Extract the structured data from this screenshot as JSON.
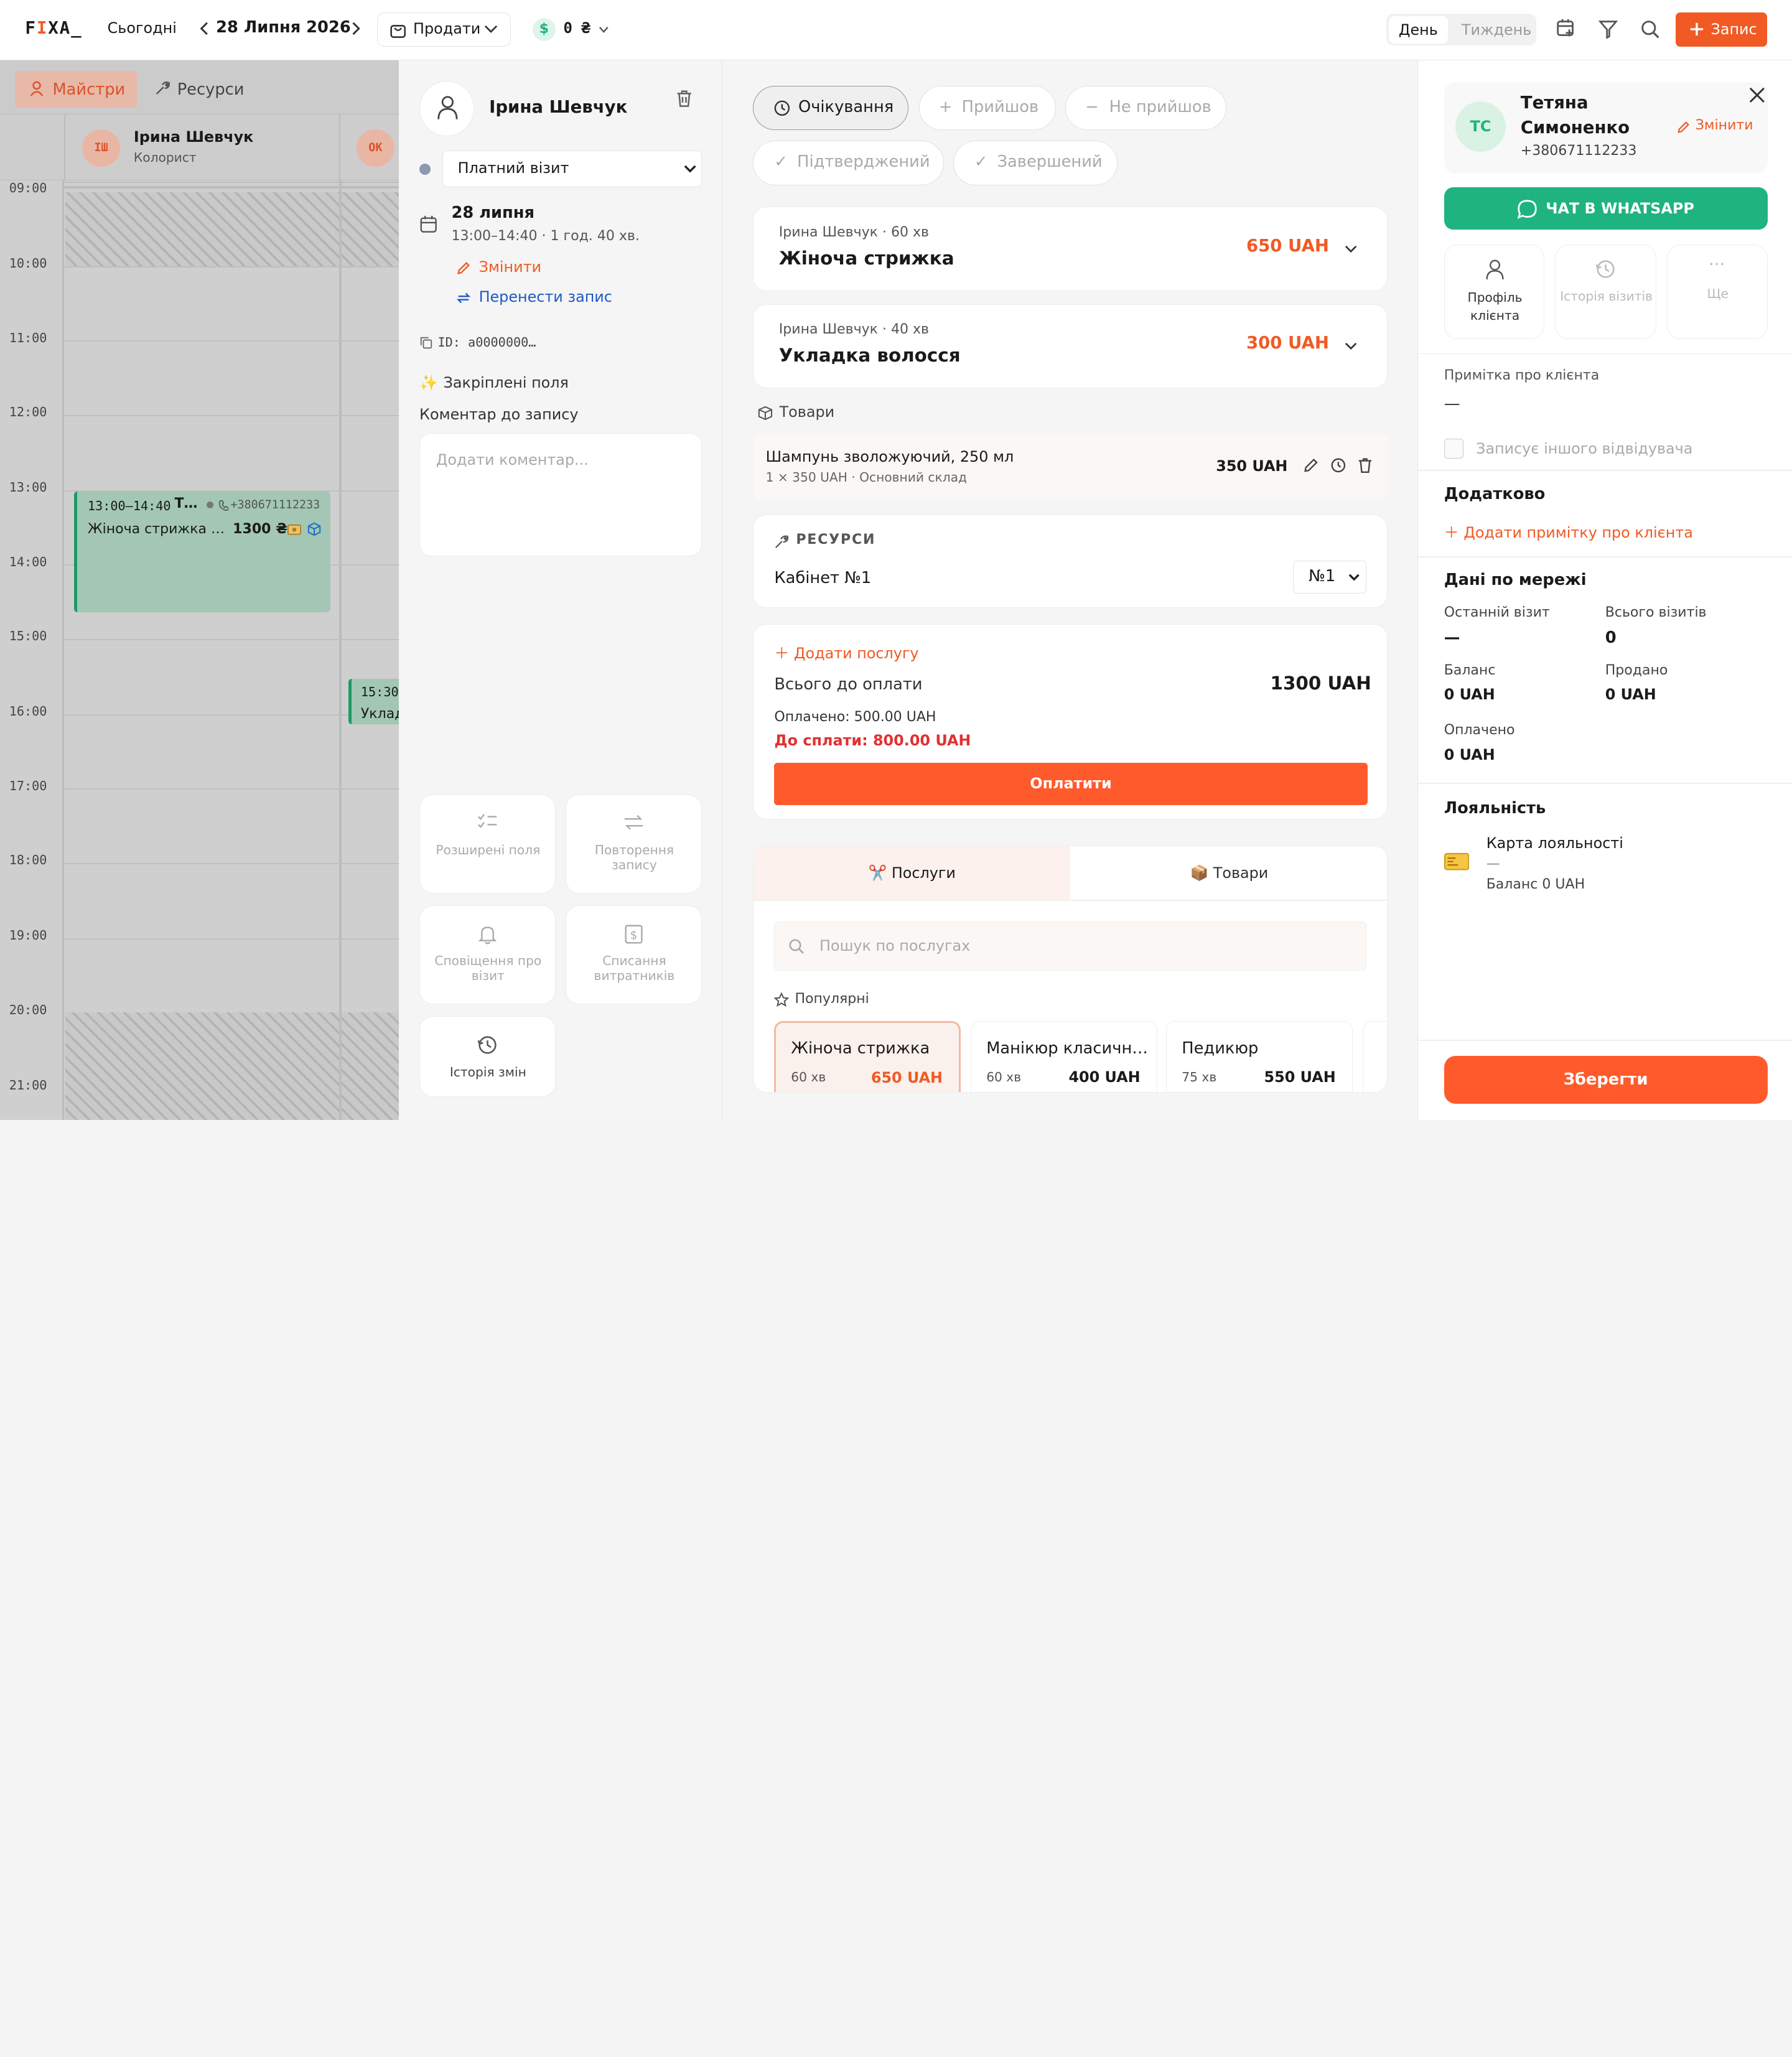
{
  "topbar": {
    "logo_a": "F",
    "logo_b": "I",
    "logo_c": "XA_",
    "today": "Сьогодні",
    "date": "28 Липня 2026",
    "sell": "Продати",
    "balance": "0 ₴",
    "day": "День",
    "week": "Тиждень",
    "add_record": "Запис"
  },
  "left": {
    "tab_masters": "Майстри",
    "tab_resources": "Ресурси",
    "masters": [
      {
        "initials": "ІШ",
        "name": "Ірина Шевчук",
        "role": "Колорист"
      },
      {
        "initials": "ОК"
      }
    ],
    "hours": [
      "09:00",
      "10:00",
      "11:00",
      "12:00",
      "13:00",
      "14:00",
      "15:00",
      "16:00",
      "17:00",
      "18:00",
      "19:00",
      "20:00",
      "21:00"
    ],
    "appt1": {
      "time": "13:00–14:40",
      "client": "Т…",
      "phone": "+380671112233",
      "service": "Жіноча стрижка …",
      "price": "1300 ₴"
    },
    "appt2": {
      "time": "15:30",
      "service": "Уклад"
    }
  },
  "booking": {
    "master": "Ірина Шевчук",
    "visit_type": "Платний візит",
    "date": "28 липня",
    "time": "13:00–14:40 · 1 год. 40 хв.",
    "edit": "Змінити",
    "reschedule": "Перенести запис",
    "id": "ID: a0000000…",
    "pinned": "Закріплені поля",
    "comment_label": "Коментар до запису",
    "comment_placeholder": "Додати коментар...",
    "tiles": [
      {
        "label": "Розширені поля"
      },
      {
        "label": "Повторення запису"
      },
      {
        "label": "Сповіщення про візит"
      },
      {
        "label": "Списання витратників"
      },
      {
        "label": "Історія змін"
      }
    ]
  },
  "status": {
    "waiting": "Очікування",
    "came": "Прийшов",
    "not_came": "Не прийшов",
    "confirmed": "Підтверджений",
    "completed": "Завершений"
  },
  "services": [
    {
      "meta": "Ірина Шевчук · 60 хв",
      "name": "Жіноча стрижка",
      "price": "650 UAH"
    },
    {
      "meta": "Ірина Шевчук · 40 хв",
      "name": "Укладка волосся",
      "price": "300 UAH"
    }
  ],
  "goods": {
    "title": "Товари",
    "item": "Шампунь зволожуючий, 250 мл",
    "sub": "1 × 350 UAH · Основний склад",
    "price": "350 UAH"
  },
  "resources": {
    "title": "РЕСУРСИ",
    "cabinet": "Кабінет №1",
    "select": "№1"
  },
  "payment": {
    "add_service": "Додати послугу",
    "total_label": "Всього до оплати",
    "total": "1300 UAH",
    "paid": "Оплачено: 500.00 UAH",
    "due": "До сплати: 800.00 UAH",
    "pay": "Оплатити"
  },
  "catalog": {
    "tab_services": "✂️ Послуги",
    "tab_goods": "📦 Товари",
    "search_placeholder": "Пошук по послугах",
    "popular": "Популярні",
    "cards": [
      {
        "name": "Жіноча стрижка",
        "dur": "60 хв",
        "price": "650 UAH"
      },
      {
        "name": "Манікюр класичн…",
        "dur": "60 хв",
        "price": "400 UAH"
      },
      {
        "name": "Педикюр",
        "dur": "75 хв",
        "price": "550 UAH"
      }
    ]
  },
  "client": {
    "initials": "ТС",
    "name1": "Тетяна",
    "name2": "Симоненко",
    "phone": "+380671112233",
    "edit": "Змінити",
    "whatsapp": "ЧАТ В WHATSAPP",
    "profile": "Профіль клієнта",
    "history": "Історія візитів",
    "more": "Ще",
    "note_label": "Примітка про клієнта",
    "note_value": "—",
    "other_visitor": "Записує іншого відвідувача",
    "extra": "Додатково",
    "add_note": "Додати примітку про клієнта",
    "network": "Дані по мережі",
    "stats": [
      {
        "label": "Останній візит",
        "value": "—"
      },
      {
        "label": "Всього візитів",
        "value": "0"
      },
      {
        "label": "Баланс",
        "value": "0 UAH"
      },
      {
        "label": "Продано",
        "value": "0 UAH"
      },
      {
        "label": "Оплачено",
        "value": "0 UAH"
      }
    ],
    "loyalty": "Лояльність",
    "card_label": "Карта лояльності",
    "card_dash": "—",
    "card_balance": "Баланс 0 UAH",
    "save": "Зберегти"
  },
  "colors": {
    "accent": "#f15a24",
    "whatsapp": "#1fb380",
    "link": "#1c5ac7"
  }
}
